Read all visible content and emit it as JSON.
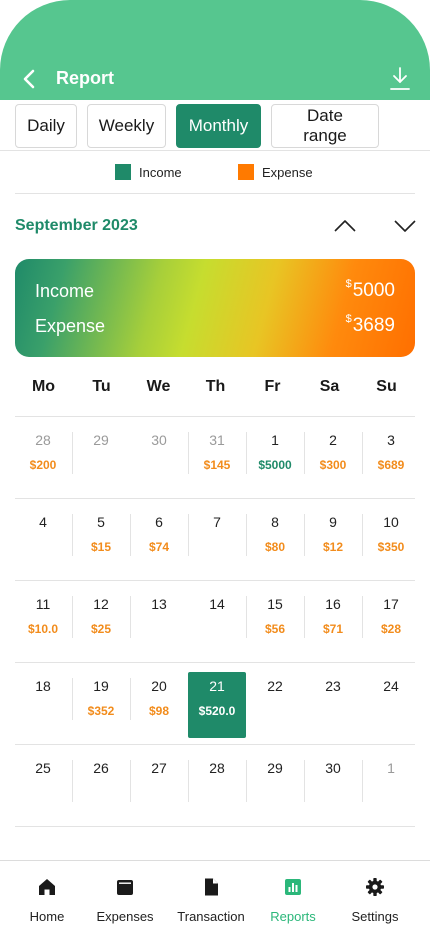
{
  "header": {
    "title": "Report"
  },
  "tabs": [
    {
      "label": "Daily",
      "active": false
    },
    {
      "label": "Weekly",
      "active": false
    },
    {
      "label": "Monthly",
      "active": true
    },
    {
      "label": "Date range",
      "active": false
    }
  ],
  "legend": {
    "income_label": "Income",
    "income_color": "#1f8a69",
    "expense_label": "Expense",
    "expense_color": "#ff7a00"
  },
  "month": {
    "title": "September 2023"
  },
  "summary": {
    "income_label": "Income",
    "income_currency": "$",
    "income_value": "5000",
    "expense_label": "Expense",
    "expense_currency": "$",
    "expense_value": "3689"
  },
  "weekdays": [
    "Mo",
    "Tu",
    "We",
    "Th",
    "Fr",
    "Sa",
    "Su"
  ],
  "calendar": {
    "weeks": [
      [
        {
          "day": "28",
          "amount": "$200",
          "muted": true
        },
        {
          "day": "29",
          "muted": true
        },
        {
          "day": "30",
          "muted": true
        },
        {
          "day": "31",
          "amount": "$145",
          "muted": true
        },
        {
          "day": "1",
          "amount": "$5000",
          "type": "income"
        },
        {
          "day": "2",
          "amount": "$300"
        },
        {
          "day": "3",
          "amount": "$689"
        }
      ],
      [
        {
          "day": "4"
        },
        {
          "day": "5",
          "amount": "$15"
        },
        {
          "day": "6",
          "amount": "$74"
        },
        {
          "day": "7"
        },
        {
          "day": "8",
          "amount": "$80"
        },
        {
          "day": "9",
          "amount": "$12"
        },
        {
          "day": "10",
          "amount": "$350"
        }
      ],
      [
        {
          "day": "11",
          "amount": "$10.0"
        },
        {
          "day": "12",
          "amount": "$25"
        },
        {
          "day": "13"
        },
        {
          "day": "14"
        },
        {
          "day": "15",
          "amount": "$56"
        },
        {
          "day": "16",
          "amount": "$71"
        },
        {
          "day": "17",
          "amount": "$28"
        }
      ],
      [
        {
          "day": "18"
        },
        {
          "day": "19",
          "amount": "$352"
        },
        {
          "day": "20",
          "amount": "$98"
        },
        {
          "day": "21",
          "amount": "$520.0",
          "selected": true
        },
        {
          "day": "22"
        },
        {
          "day": "23"
        },
        {
          "day": "24"
        }
      ],
      [
        {
          "day": "25"
        },
        {
          "day": "26"
        },
        {
          "day": "27"
        },
        {
          "day": "28"
        },
        {
          "day": "29"
        },
        {
          "day": "30"
        },
        {
          "day": "1",
          "muted": true
        }
      ]
    ]
  },
  "bottom_nav": [
    {
      "label": "Home",
      "icon": "home-icon",
      "active": false
    },
    {
      "label": "Expenses",
      "icon": "wallet-icon",
      "active": false
    },
    {
      "label": "Transaction",
      "icon": "document-icon",
      "active": false
    },
    {
      "label": "Reports",
      "icon": "chart-icon",
      "active": true
    },
    {
      "label": "Settings",
      "icon": "gear-icon",
      "active": false
    }
  ],
  "colors": {
    "header": "#56c68f",
    "accent": "#1f8a69",
    "expense_amount": "#f28c1c",
    "active_nav": "#2bb77a"
  }
}
